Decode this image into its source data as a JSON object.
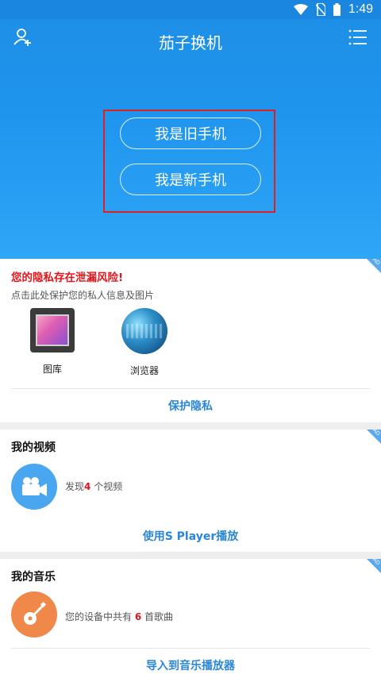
{
  "status_bar": {
    "time": "1:49",
    "icons": [
      "wifi-icon",
      "no-sim-icon",
      "battery-icon"
    ]
  },
  "header": {
    "title": "茄子换机",
    "left_icon": "add-user-icon",
    "right_icon": "menu-list-icon"
  },
  "hero": {
    "old_phone_label": "我是旧手机",
    "new_phone_label": "我是新手机",
    "highlight_color": "#e02020"
  },
  "privacy_card": {
    "ad_badge": "AD",
    "warning": "您的隐私存在泄漏风险!",
    "subtitle": "点击此处保护您的私人信息及图片",
    "apps": [
      {
        "label": "图库",
        "icon": "gallery-icon"
      },
      {
        "label": "浏览器",
        "icon": "browser-globe-icon"
      }
    ],
    "action": "保护隐私"
  },
  "video_card": {
    "ad_badge": "AD",
    "title": "我的视频",
    "desc_prefix": "发现",
    "desc_count": "4",
    "desc_suffix": " 个视频",
    "action": "使用S Player播放",
    "icon": "video-camera-icon"
  },
  "music_card": {
    "ad_badge": "AD",
    "title": "我的音乐",
    "desc_prefix": "您的设备中共有 ",
    "desc_count": "6",
    "desc_suffix": " 首歌曲",
    "action": "导入到音乐播放器",
    "icon": "guitar-icon"
  },
  "colors": {
    "primary": "#1f95ee",
    "accent_link": "#2b86d6",
    "warning": "#e0141a"
  }
}
